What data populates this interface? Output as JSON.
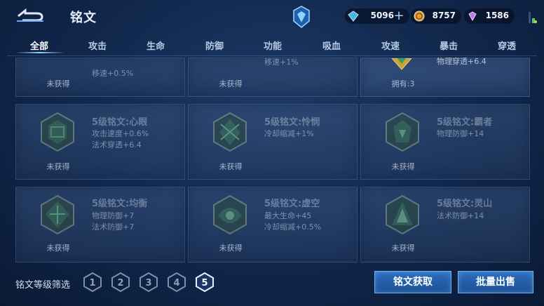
{
  "header": {
    "title": "铭文",
    "resources": [
      {
        "name": "diamond",
        "value": "5096",
        "color": "#46b4e8"
      },
      {
        "name": "gold-coin",
        "value": "8757",
        "color": "#e0a042"
      },
      {
        "name": "crystal",
        "value": "1586",
        "color": "#c07ae8"
      }
    ]
  },
  "tabs": [
    {
      "label": "全部",
      "active": true
    },
    {
      "label": "攻击"
    },
    {
      "label": "生命"
    },
    {
      "label": "防御"
    },
    {
      "label": "功能"
    },
    {
      "label": "吸血"
    },
    {
      "label": "攻速"
    },
    {
      "label": "暴击"
    },
    {
      "label": "穿透"
    }
  ],
  "cards_top": [
    {
      "stats": [
        "移速+0.5%"
      ],
      "status": "未获得"
    },
    {
      "stats": [
        "移速+1%"
      ],
      "status": "未获得"
    },
    {
      "stats": [
        "物理穿透+6.4"
      ],
      "status": "拥有:3"
    }
  ],
  "cards": [
    {
      "name": "5级铭文:心眼",
      "stats": [
        "攻击速度+0.6%",
        "法术穿透+6.4"
      ],
      "status": "未获得"
    },
    {
      "name": "5级铭文:怜悯",
      "stats": [
        "冷却缩减+1%"
      ],
      "status": "未获得"
    },
    {
      "name": "5级铭文:霸者",
      "stats": [
        "物理防御+14"
      ],
      "status": "未获得"
    },
    {
      "name": "5级铭文:均衡",
      "stats": [
        "物理防御+7",
        "法术防御+7"
      ],
      "status": "未获得"
    },
    {
      "name": "5级铭文:虚空",
      "stats": [
        "最大生命+45",
        "冷却缩减+0.5%"
      ],
      "status": "未获得"
    },
    {
      "name": "5级铭文:灵山",
      "stats": [
        "法术防御+14"
      ],
      "status": "未获得"
    }
  ],
  "footer": {
    "filter_label": "铭文等级筛选",
    "levels": [
      "1",
      "2",
      "3",
      "4",
      "5"
    ],
    "selected_level": "5",
    "acquire_button": "铭文获取",
    "sell_button": "批量出售"
  }
}
